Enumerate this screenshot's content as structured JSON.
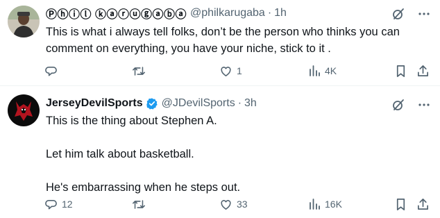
{
  "tweets": [
    {
      "display_name": "Ⓟⓗⓘⓛ ⓚⓐⓡⓤⓖⓐⓑⓐ",
      "handle": "@philkarugaba",
      "separator": "·",
      "time": "1h",
      "verified": false,
      "body_paragraphs": [
        "This is what i always tell folks, don’t be the person who thinks you can comment on everything, you have your niche, stick to it ."
      ],
      "replies": "",
      "retweets": "",
      "likes": "1",
      "views": "4K"
    },
    {
      "display_name": "JerseyDevilSports",
      "handle": "@JDevilSports",
      "separator": "·",
      "time": "3h",
      "verified": true,
      "body_paragraphs": [
        "This is the thing about Stephen A.",
        "Let him talk about basketball.",
        "He's embarrassing when he steps out."
      ],
      "replies": "12",
      "retweets": "",
      "likes": "33",
      "views": "16K"
    }
  ],
  "colors": {
    "text": "#0f1419",
    "secondary": "#536471",
    "verified_blue": "#1d9bf0",
    "divider": "#eff3f4"
  },
  "icons": {
    "reply": "reply-icon",
    "retweet": "retweet-icon",
    "like": "heart-icon",
    "views": "views-icon",
    "bookmark": "bookmark-icon",
    "share": "share-icon",
    "grok": "grok-icon",
    "more": "more-icon"
  }
}
